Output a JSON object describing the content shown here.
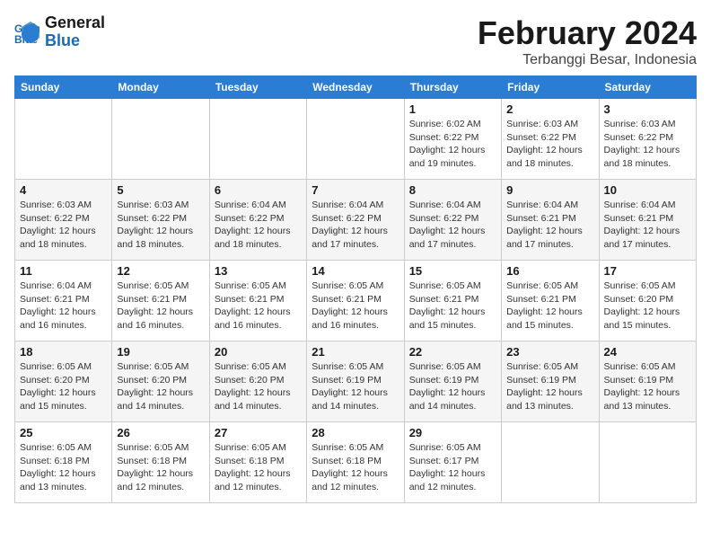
{
  "header": {
    "logo_line1": "General",
    "logo_line2": "Blue",
    "month_year": "February 2024",
    "location": "Terbanggi Besar, Indonesia"
  },
  "weekdays": [
    "Sunday",
    "Monday",
    "Tuesday",
    "Wednesday",
    "Thursday",
    "Friday",
    "Saturday"
  ],
  "weeks": [
    [
      {
        "day": "",
        "info": ""
      },
      {
        "day": "",
        "info": ""
      },
      {
        "day": "",
        "info": ""
      },
      {
        "day": "",
        "info": ""
      },
      {
        "day": "1",
        "info": "Sunrise: 6:02 AM\nSunset: 6:22 PM\nDaylight: 12 hours\nand 19 minutes."
      },
      {
        "day": "2",
        "info": "Sunrise: 6:03 AM\nSunset: 6:22 PM\nDaylight: 12 hours\nand 18 minutes."
      },
      {
        "day": "3",
        "info": "Sunrise: 6:03 AM\nSunset: 6:22 PM\nDaylight: 12 hours\nand 18 minutes."
      }
    ],
    [
      {
        "day": "4",
        "info": "Sunrise: 6:03 AM\nSunset: 6:22 PM\nDaylight: 12 hours\nand 18 minutes."
      },
      {
        "day": "5",
        "info": "Sunrise: 6:03 AM\nSunset: 6:22 PM\nDaylight: 12 hours\nand 18 minutes."
      },
      {
        "day": "6",
        "info": "Sunrise: 6:04 AM\nSunset: 6:22 PM\nDaylight: 12 hours\nand 18 minutes."
      },
      {
        "day": "7",
        "info": "Sunrise: 6:04 AM\nSunset: 6:22 PM\nDaylight: 12 hours\nand 17 minutes."
      },
      {
        "day": "8",
        "info": "Sunrise: 6:04 AM\nSunset: 6:22 PM\nDaylight: 12 hours\nand 17 minutes."
      },
      {
        "day": "9",
        "info": "Sunrise: 6:04 AM\nSunset: 6:21 PM\nDaylight: 12 hours\nand 17 minutes."
      },
      {
        "day": "10",
        "info": "Sunrise: 6:04 AM\nSunset: 6:21 PM\nDaylight: 12 hours\nand 17 minutes."
      }
    ],
    [
      {
        "day": "11",
        "info": "Sunrise: 6:04 AM\nSunset: 6:21 PM\nDaylight: 12 hours\nand 16 minutes."
      },
      {
        "day": "12",
        "info": "Sunrise: 6:05 AM\nSunset: 6:21 PM\nDaylight: 12 hours\nand 16 minutes."
      },
      {
        "day": "13",
        "info": "Sunrise: 6:05 AM\nSunset: 6:21 PM\nDaylight: 12 hours\nand 16 minutes."
      },
      {
        "day": "14",
        "info": "Sunrise: 6:05 AM\nSunset: 6:21 PM\nDaylight: 12 hours\nand 16 minutes."
      },
      {
        "day": "15",
        "info": "Sunrise: 6:05 AM\nSunset: 6:21 PM\nDaylight: 12 hours\nand 15 minutes."
      },
      {
        "day": "16",
        "info": "Sunrise: 6:05 AM\nSunset: 6:21 PM\nDaylight: 12 hours\nand 15 minutes."
      },
      {
        "day": "17",
        "info": "Sunrise: 6:05 AM\nSunset: 6:20 PM\nDaylight: 12 hours\nand 15 minutes."
      }
    ],
    [
      {
        "day": "18",
        "info": "Sunrise: 6:05 AM\nSunset: 6:20 PM\nDaylight: 12 hours\nand 15 minutes."
      },
      {
        "day": "19",
        "info": "Sunrise: 6:05 AM\nSunset: 6:20 PM\nDaylight: 12 hours\nand 14 minutes."
      },
      {
        "day": "20",
        "info": "Sunrise: 6:05 AM\nSunset: 6:20 PM\nDaylight: 12 hours\nand 14 minutes."
      },
      {
        "day": "21",
        "info": "Sunrise: 6:05 AM\nSunset: 6:19 PM\nDaylight: 12 hours\nand 14 minutes."
      },
      {
        "day": "22",
        "info": "Sunrise: 6:05 AM\nSunset: 6:19 PM\nDaylight: 12 hours\nand 14 minutes."
      },
      {
        "day": "23",
        "info": "Sunrise: 6:05 AM\nSunset: 6:19 PM\nDaylight: 12 hours\nand 13 minutes."
      },
      {
        "day": "24",
        "info": "Sunrise: 6:05 AM\nSunset: 6:19 PM\nDaylight: 12 hours\nand 13 minutes."
      }
    ],
    [
      {
        "day": "25",
        "info": "Sunrise: 6:05 AM\nSunset: 6:18 PM\nDaylight: 12 hours\nand 13 minutes."
      },
      {
        "day": "26",
        "info": "Sunrise: 6:05 AM\nSunset: 6:18 PM\nDaylight: 12 hours\nand 12 minutes."
      },
      {
        "day": "27",
        "info": "Sunrise: 6:05 AM\nSunset: 6:18 PM\nDaylight: 12 hours\nand 12 minutes."
      },
      {
        "day": "28",
        "info": "Sunrise: 6:05 AM\nSunset: 6:18 PM\nDaylight: 12 hours\nand 12 minutes."
      },
      {
        "day": "29",
        "info": "Sunrise: 6:05 AM\nSunset: 6:17 PM\nDaylight: 12 hours\nand 12 minutes."
      },
      {
        "day": "",
        "info": ""
      },
      {
        "day": "",
        "info": ""
      }
    ]
  ]
}
